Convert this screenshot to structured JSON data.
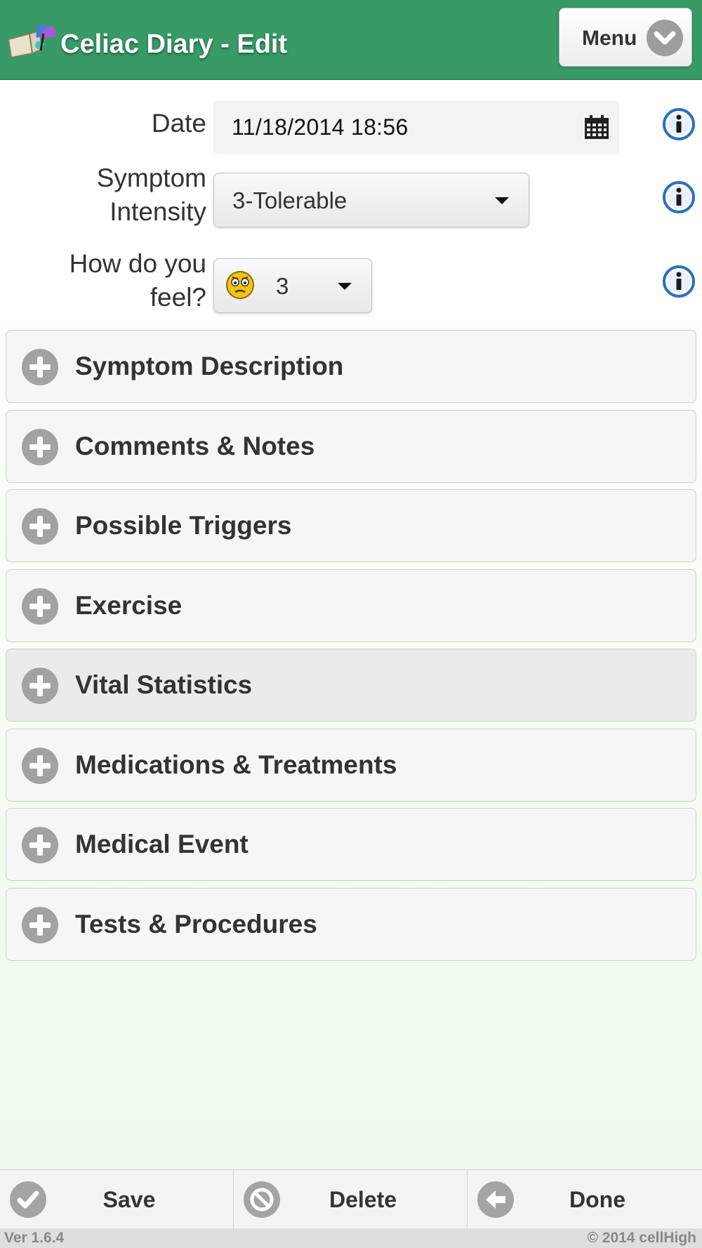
{
  "header": {
    "title": "Celiac Diary - Edit",
    "menu_label": "Menu",
    "logo_icon": "book-butterfly-logo"
  },
  "form": {
    "date": {
      "label": "Date",
      "value": "11/18/2014 18:56",
      "icon": "calendar-icon"
    },
    "symptom_intensity": {
      "label_line1": "Symptom",
      "label_line2": "Intensity",
      "value": "3-Tolerable"
    },
    "feel": {
      "label_line1": "How do you",
      "label_line2": "feel?",
      "value": "3",
      "icon": "worried-smiley-icon"
    },
    "info_icon": "info-icon"
  },
  "sections": [
    {
      "title": "Symptom Description"
    },
    {
      "title": "Comments & Notes"
    },
    {
      "title": "Possible Triggers"
    },
    {
      "title": "Exercise"
    },
    {
      "title": "Vital Statistics"
    },
    {
      "title": "Medications & Treatments"
    },
    {
      "title": "Medical Event"
    },
    {
      "title": "Tests & Procedures"
    }
  ],
  "footer": {
    "save_label": "Save",
    "delete_label": "Delete",
    "done_label": "Done",
    "version": "Ver 1.6.4",
    "copyright": "© 2014 cellHigh"
  },
  "colors": {
    "header_bg": "#379a67",
    "info_blue": "#2a6fc4",
    "icon_gray": "#a2a2a2"
  }
}
